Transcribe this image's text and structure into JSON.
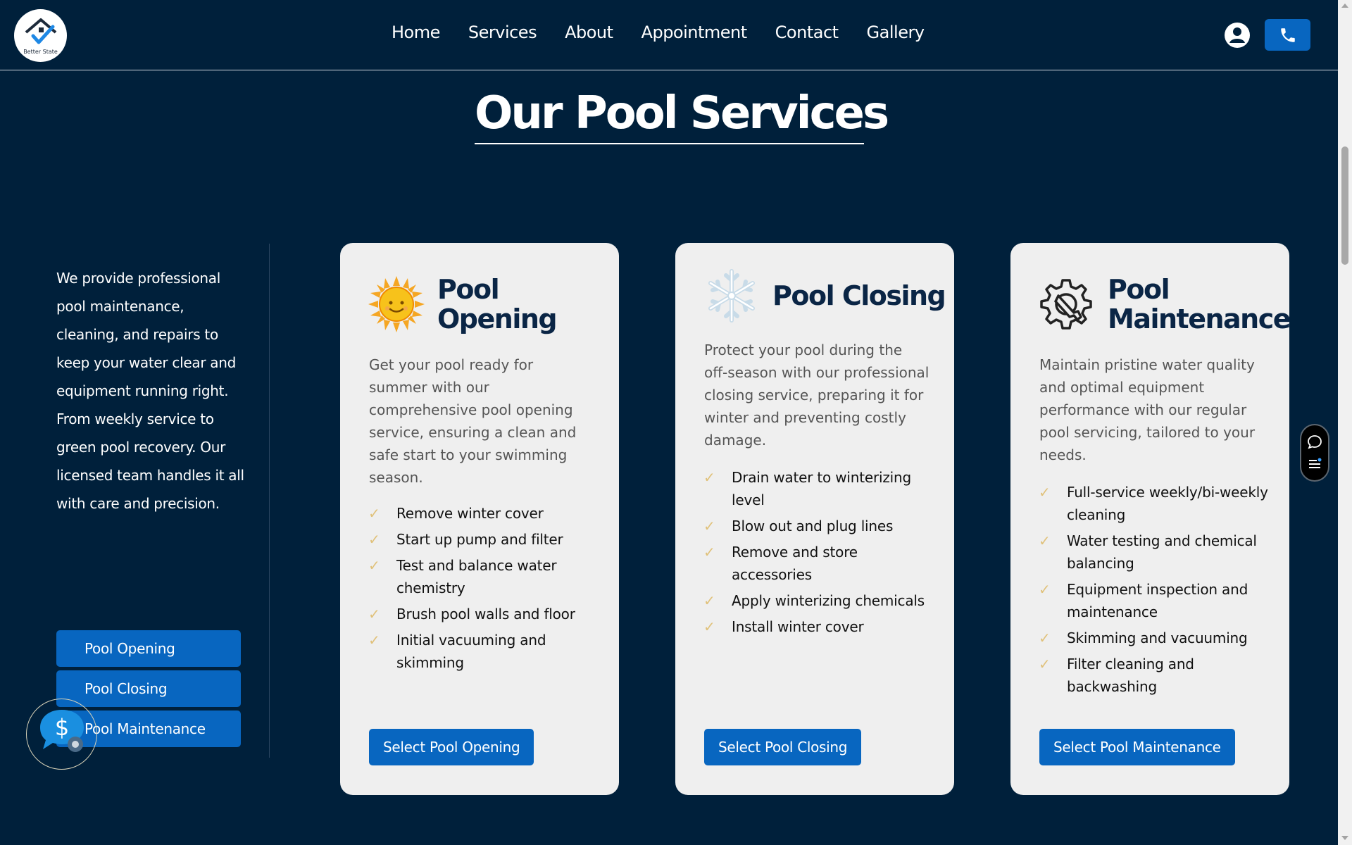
{
  "header": {
    "logo_text": "Better State",
    "nav": [
      "Home",
      "Services",
      "About",
      "Appointment",
      "Contact",
      "Gallery"
    ]
  },
  "page": {
    "title": "Our Pool Services",
    "intro": "We provide professional pool maintenance, cleaning, and repairs to keep your water clear and equipment running right. From weekly service to green pool recovery. Our licensed team handles it all with care and precision."
  },
  "side_buttons": [
    "Pool Opening",
    "Pool Closing",
    "Pool Maintenance"
  ],
  "cards": [
    {
      "icon": "sun-icon",
      "title": "Pool Opening",
      "description": "Get your pool ready for summer with our comprehensive pool opening service, ensuring a clean and safe start to your swimming season.",
      "features": [
        "Remove winter cover",
        "Start up pump and filter",
        "Test and balance water chemistry",
        "Brush pool walls and floor",
        "Initial vacuuming and skimming"
      ],
      "button": "Select Pool Opening"
    },
    {
      "icon": "snowflake-icon",
      "title": "Pool Closing",
      "description": "Protect your pool during the off-season with our professional closing service, preparing it for winter and preventing costly damage.",
      "features": [
        "Drain water to winterizing level",
        "Blow out and plug lines",
        "Remove and store accessories",
        "Apply winterizing chemicals",
        "Install winter cover"
      ],
      "button": "Select Pool Closing"
    },
    {
      "icon": "gear-wrench-icon",
      "title": "Pool Maintenance",
      "description": "Maintain pristine water quality and optimal equipment performance with our regular pool servicing, tailored to your needs.",
      "features": [
        "Full-service weekly/bi-weekly cleaning",
        "Water testing and chemical balancing",
        "Equipment inspection and maintenance",
        "Skimming and vacuuming",
        "Filter cleaning and backwashing"
      ],
      "button": "Select Pool Maintenance"
    }
  ],
  "check_glyph": "✓",
  "colors": {
    "background": "#00203b",
    "accent": "#0866c0",
    "card": "#efefef",
    "heading": "#0a2545",
    "check": "#e0c17a"
  }
}
